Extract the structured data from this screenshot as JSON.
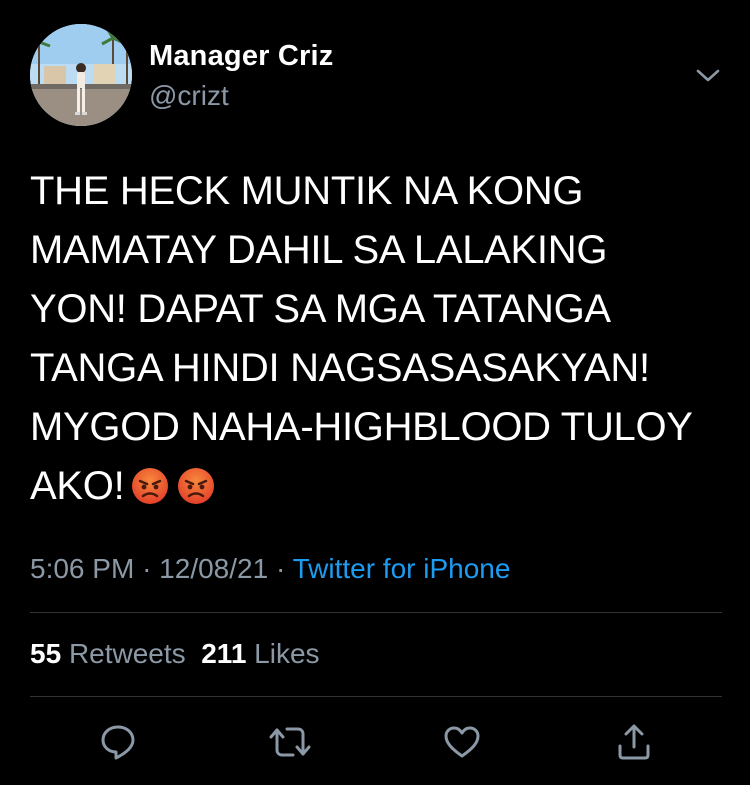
{
  "author": {
    "display_name": "Manager Criz",
    "handle": "@crizt",
    "avatar_icon": "profile-photo"
  },
  "tweet": {
    "lines": [
      "THE HECK MUNTIK NA KONG",
      "MAMATAY DAHIL SA LALAKING",
      "YON! DAPAT SA MGA TATANGA",
      "TANGA HINDI NAGSASASAKYAN!",
      "MYGOD NAHA-HIGHBLOOD TULOY",
      "AKO!"
    ],
    "emojis": [
      "angry-face",
      "angry-face"
    ]
  },
  "meta": {
    "time": "5:06 PM",
    "separator": "·",
    "date": "12/08/21",
    "source": "Twitter for iPhone"
  },
  "stats": {
    "retweets_count": "55",
    "retweets_label": "Retweets",
    "likes_count": "211",
    "likes_label": "Likes"
  },
  "actions": {
    "icons": [
      "reply-icon",
      "retweet-icon",
      "like-icon",
      "share-icon"
    ]
  },
  "colors": {
    "background": "#000000",
    "text": "#ffffff",
    "secondary": "#8b98a5",
    "accent": "#1d9bf0",
    "divider": "#2f3336"
  }
}
